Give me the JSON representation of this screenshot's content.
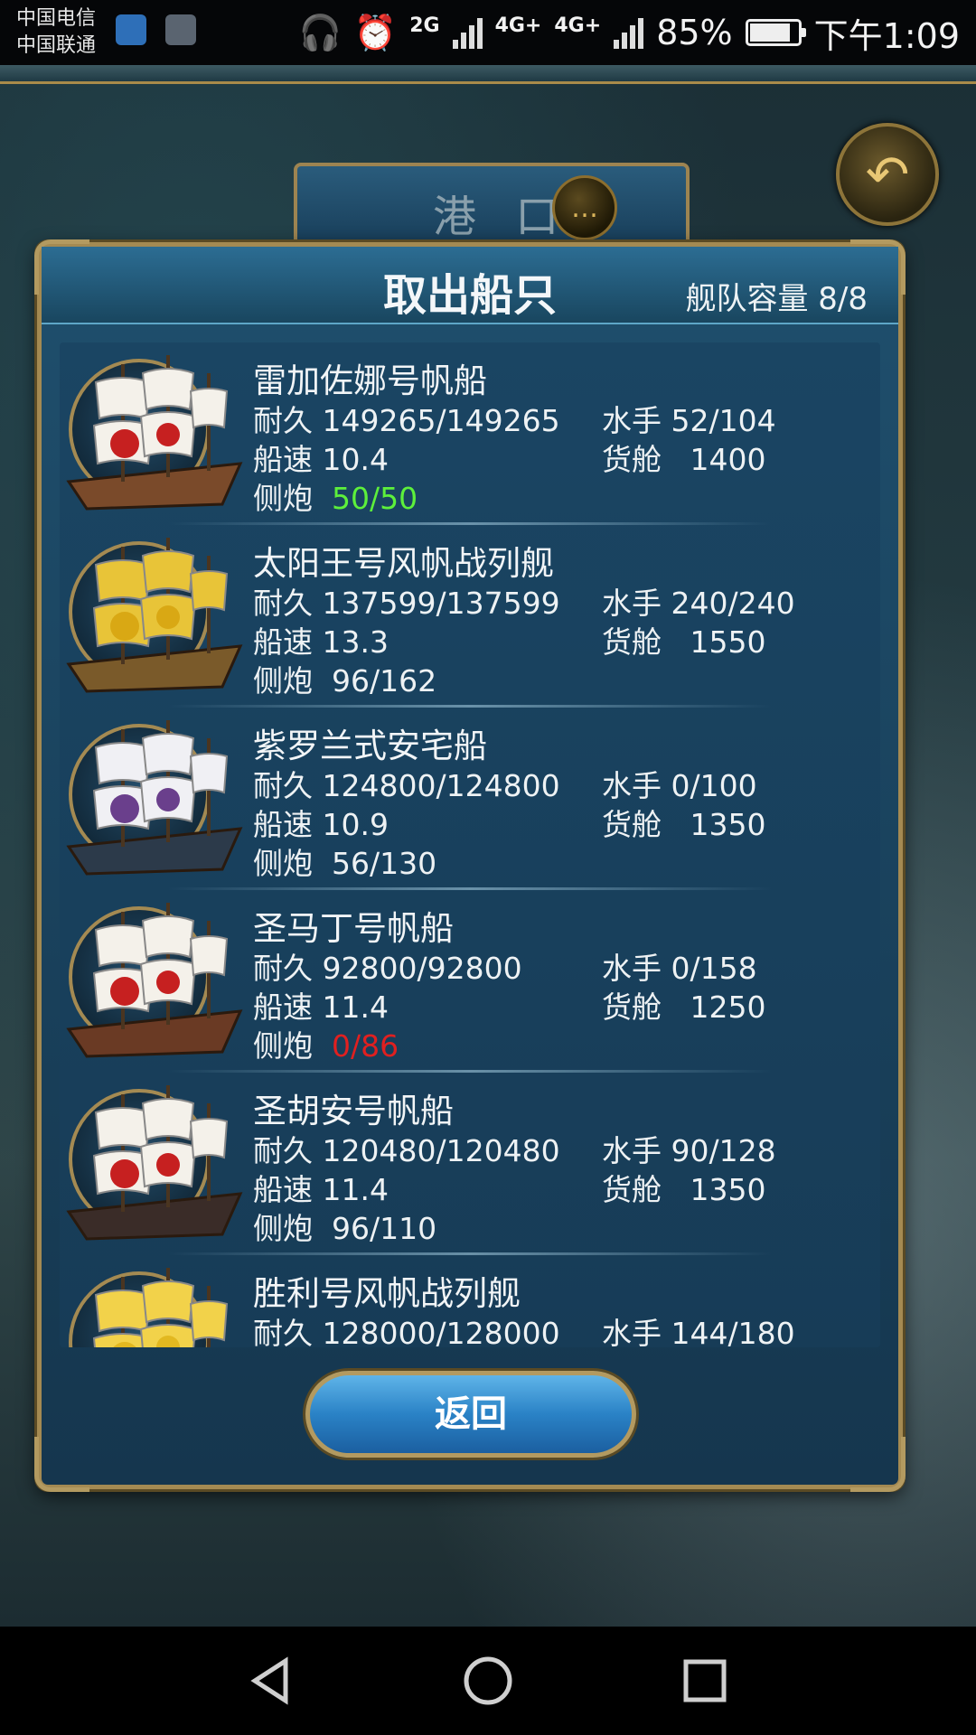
{
  "status_bar": {
    "carrier1": "中国电信",
    "carrier2": "中国联通",
    "network_2g": "2G",
    "network_4g": "4G+",
    "network_4g_b": "4G+",
    "battery": "85%",
    "battery_level": 0.85,
    "time": "下午1:09"
  },
  "background": {
    "port_title": "港 口"
  },
  "panel": {
    "title": "取出船只",
    "fleet_capacity": "舰队容量 8/8",
    "return_label": "返回"
  },
  "labels": {
    "durability": "耐久",
    "sailors": "水手",
    "speed": "船速",
    "cargo": "货舱",
    "cannons": "侧炮"
  },
  "ships": [
    {
      "name": "雷加佐娜号帆船",
      "durability": "149265/149265",
      "sailors": "52/104",
      "speed": "10.4",
      "cargo": "1400",
      "cannons": "50/50",
      "cannon_status": "green"
    },
    {
      "name": "太阳王号风帆战列舰",
      "durability": "137599/137599",
      "sailors": "240/240",
      "speed": "13.3",
      "cargo": "1550",
      "cannons": "96/162",
      "cannon_status": "normal"
    },
    {
      "name": "紫罗兰式安宅船",
      "durability": "124800/124800",
      "sailors": "0/100",
      "speed": "10.9",
      "cargo": "1350",
      "cannons": "56/130",
      "cannon_status": "normal"
    },
    {
      "name": "圣马丁号帆船",
      "durability": "92800/92800",
      "sailors": "0/158",
      "speed": "11.4",
      "cargo": "1250",
      "cannons": "0/86",
      "cannon_status": "red"
    },
    {
      "name": "圣胡安号帆船",
      "durability": "120480/120480",
      "sailors": "90/128",
      "speed": "11.4",
      "cargo": "1350",
      "cannons": "96/110",
      "cannon_status": "normal"
    },
    {
      "name": "胜利号风帆战列舰",
      "durability": "128000/128000",
      "sailors": "144/180",
      "speed": "",
      "cargo": "",
      "cannons": "",
      "cannon_status": "normal"
    }
  ],
  "colors": {
    "green": "#5df03b",
    "red": "#e02020",
    "gold": "#a48a52"
  }
}
